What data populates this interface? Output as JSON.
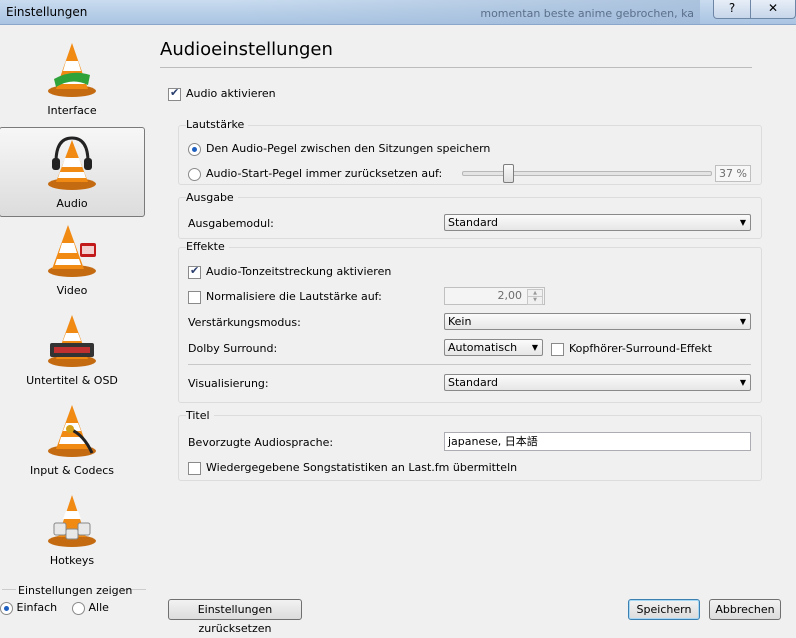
{
  "window": {
    "title": "Einstellungen",
    "help_glyph": "?",
    "close_glyph": "✕",
    "bg_blur_text": "momentan beste anime gebrochen, ka"
  },
  "sidebar": {
    "items": [
      {
        "label": "Interface",
        "icon": "vlc-cone-icon"
      },
      {
        "label": "Audio",
        "icon": "vlc-cone-headphones-icon"
      },
      {
        "label": "Video",
        "icon": "vlc-cone-film-icon"
      },
      {
        "label": "Untertitel & OSD",
        "icon": "vlc-cone-subtitles-icon"
      },
      {
        "label": "Input & Codecs",
        "icon": "vlc-cone-cable-icon"
      },
      {
        "label": "Hotkeys",
        "icon": "vlc-cone-hotkeys-icon"
      }
    ],
    "selected": "Audio",
    "show_settings": {
      "caption": "Einstellungen zeigen",
      "options": [
        "Einfach",
        "Alle"
      ],
      "selected": "Einfach"
    }
  },
  "main": {
    "title": "Audioeinstellungen",
    "enable_audio": {
      "label": "Audio aktivieren",
      "checked": true
    },
    "volume": {
      "title": "Lautstärke",
      "save_level": {
        "label": "Den Audio-Pegel zwischen den Sitzungen speichern",
        "selected": true
      },
      "reset_level": {
        "label": "Audio-Start-Pegel immer zurücksetzen auf:",
        "selected": false
      },
      "slider_value_percent": 37,
      "value_text": "37 %"
    },
    "output": {
      "title": "Ausgabe",
      "module_label": "Ausgabemodul:",
      "module_value": "Standard"
    },
    "effects": {
      "title": "Effekte",
      "time_stretch": {
        "label": "Audio-Tonzeitstreckung aktivieren",
        "checked": true
      },
      "normalize": {
        "label": "Normalisiere die Lautstärke auf:",
        "checked": false,
        "value": "2,00"
      },
      "gain_mode_label": "Verstärkungsmodus:",
      "gain_mode_value": "Kein",
      "dolby_label": "Dolby Surround:",
      "dolby_value": "Automatisch",
      "headphone": {
        "label": "Kopfhörer-Surround-Effekt",
        "checked": false
      },
      "visualization_label": "Visualisierung:",
      "visualization_value": "Standard"
    },
    "tracks": {
      "title": "Titel",
      "preferred_lang_label": "Bevorzugte Audiosprache:",
      "preferred_lang_value": "japanese, 日本語",
      "lastfm": {
        "label": "Wiedergegebene Songstatistiken an Last.fm übermitteln",
        "checked": false
      }
    }
  },
  "footer": {
    "reset_label": "Einstellungen zurücksetzen",
    "save_label": "Speichern",
    "cancel_label": "Abbrechen"
  }
}
